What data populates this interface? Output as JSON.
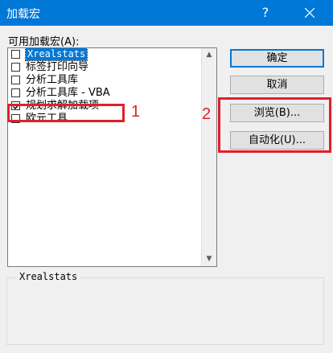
{
  "window": {
    "title": "加载宏",
    "help_glyph": "?"
  },
  "list_label": "可用加载宏(A):",
  "addins": [
    {
      "label": "Xrealstats",
      "checked": false,
      "selected": true
    },
    {
      "label": "标签打印向导",
      "checked": false,
      "selected": false
    },
    {
      "label": "分析工具库",
      "checked": false,
      "selected": false
    },
    {
      "label": "分析工具库 - VBA",
      "checked": false,
      "selected": false
    },
    {
      "label": "规划求解加载项",
      "checked": true,
      "selected": false
    },
    {
      "label": "欧元工具",
      "checked": false,
      "selected": false
    }
  ],
  "buttons": {
    "ok": "确定",
    "cancel": "取消",
    "browse": "浏览(B)...",
    "automation": "自动化(U)..."
  },
  "description": {
    "title": "Xrealstats",
    "text": ""
  },
  "annotations": {
    "box1_number": "1",
    "box2_number": "2",
    "color": "#e0202a"
  },
  "colors": {
    "titlebar": "#0078d7",
    "selection": "#0078d7",
    "dialog_bg": "#f0f0f0"
  }
}
